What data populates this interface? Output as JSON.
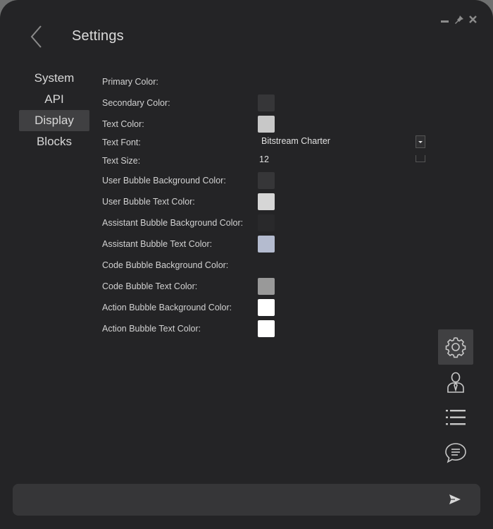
{
  "window": {
    "title": "Settings"
  },
  "nav": {
    "items": [
      {
        "label": "System"
      },
      {
        "label": "API"
      },
      {
        "label": "Display",
        "active": true
      },
      {
        "label": "Blocks"
      }
    ]
  },
  "display_settings": {
    "primary_color": {
      "label": "Primary Color:"
    },
    "secondary_color": {
      "label": "Secondary Color:",
      "color": "#363638"
    },
    "text_color": {
      "label": "Text Color:",
      "color": "#c8c8c8"
    },
    "text_font": {
      "label": "Text Font:",
      "value": "Bitstream Charter"
    },
    "text_size": {
      "label": "Text Size:",
      "value": "12"
    },
    "user_bubble_bg": {
      "label": "User Bubble Background Color:",
      "color": "#363638"
    },
    "user_bubble_text": {
      "label": "User Bubble Text Color:",
      "color": "#d6d6d6"
    },
    "assistant_bubble_bg": {
      "label": "Assistant Bubble Background Color:",
      "color": "#29292b"
    },
    "assistant_bubble_text": {
      "label": "Assistant Bubble Text Color:",
      "color": "#b4bbcf"
    },
    "code_bubble_bg": {
      "label": "Code Bubble Background Color:"
    },
    "code_bubble_text": {
      "label": "Code Bubble Text Color:",
      "color": "#999999"
    },
    "action_bubble_bg": {
      "label": "Action Bubble Background Color:",
      "color": "#ffffff"
    },
    "action_bubble_text": {
      "label": "Action Bubble Text Color:",
      "color": "#ffffff"
    }
  },
  "side_icons": [
    {
      "icon": "gear-icon",
      "active": true
    },
    {
      "icon": "user-icon"
    },
    {
      "icon": "list-icon"
    },
    {
      "icon": "chat-icon"
    }
  ],
  "colors": {
    "window_bg": "#242426",
    "panel_highlight": "#404042",
    "input_bg": "#363638",
    "text": "#d2d2d2"
  }
}
